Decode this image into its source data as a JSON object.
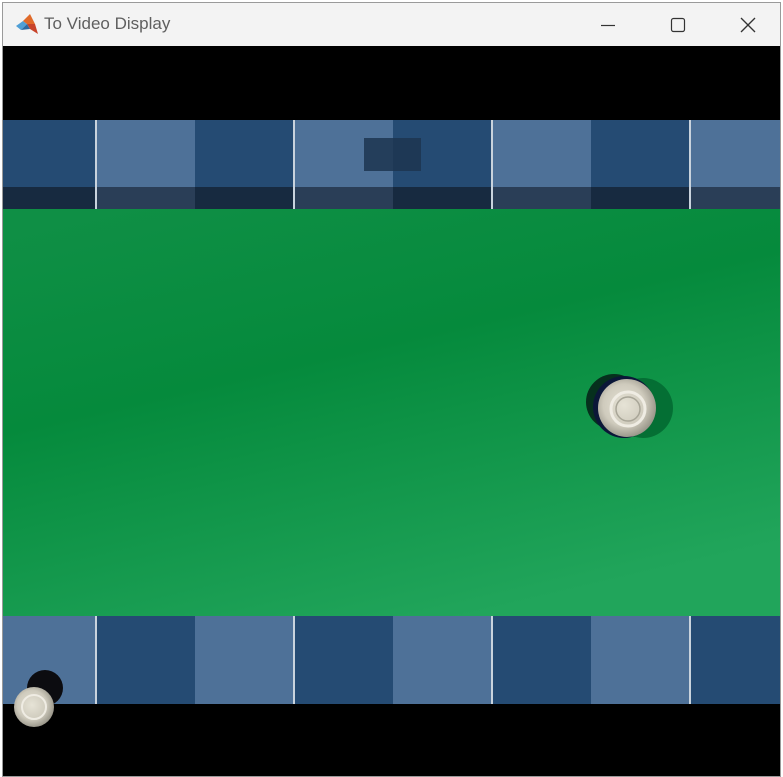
{
  "window": {
    "title": "To Video Display",
    "app_icon": "matlab-logo-icon",
    "controls": [
      "minimize-icon",
      "maximize-icon",
      "close-icon"
    ]
  },
  "colors": {
    "titlebar_bg": "#f3f3f3",
    "letterbox": "#000000",
    "felt_light": "#1fa35a",
    "felt_dark": "#02843a",
    "cushion_dark": "#254b73",
    "cushion_light": "#4e7198",
    "rail_shadow": "#172a40"
  }
}
